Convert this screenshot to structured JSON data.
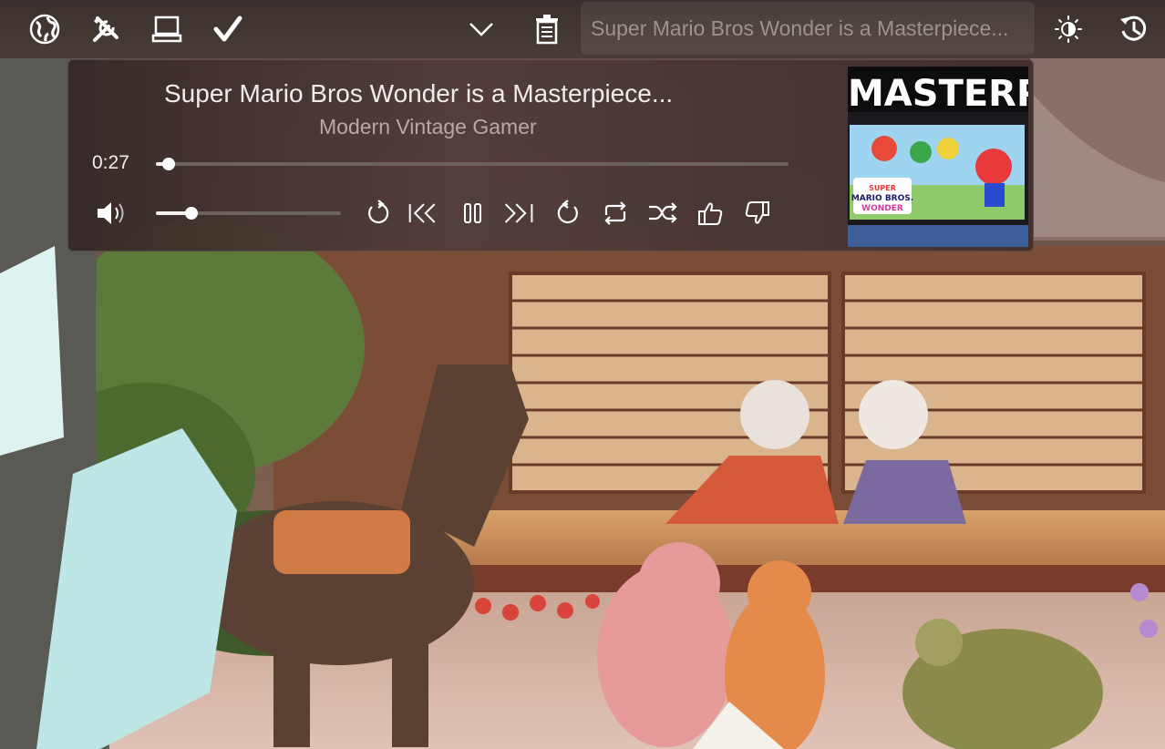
{
  "menubar": {
    "icons": [
      "globe-icon",
      "tools-icon",
      "laptop-icon",
      "checkmark-icon",
      "chevron-down-icon",
      "trash-icon",
      "brightness-icon",
      "history-icon"
    ],
    "now_playing_title": "Super Mario Bros Wonder is a Masterpiece..."
  },
  "player": {
    "title": "Super Mario Bros Wonder is a Masterpiece...",
    "artist": "Modern Vintage Gamer",
    "elapsed": "0:27",
    "progress_fraction": 0.02,
    "volume_fraction": 0.19,
    "controls": [
      "volume-icon",
      "replay-icon",
      "previous-icon",
      "pause-icon",
      "next-icon",
      "forward-icon",
      "repeat-icon",
      "shuffle-icon",
      "thumbs-up-icon",
      "thumbs-down-icon"
    ],
    "thumbnail_text": "MASTERPIECE",
    "thumbnail_logo": "SUPER MARIO BROS. WONDER"
  },
  "colors": {
    "menubar_bg": "#3a302d",
    "panel_bg": "#4a3836",
    "text_primary": "#f1ecea",
    "text_secondary": "#b7aaa6"
  }
}
